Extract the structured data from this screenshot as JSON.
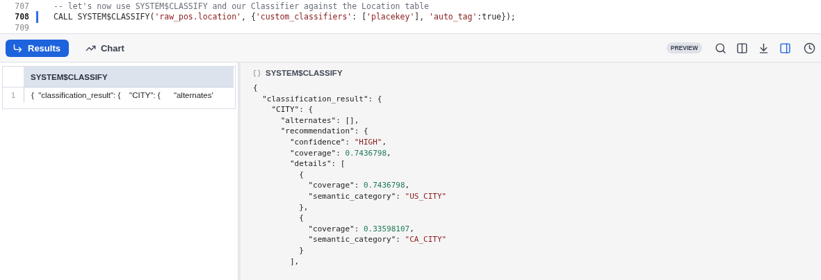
{
  "editor": {
    "lines": [
      {
        "number": "707",
        "active": false,
        "tokens": [
          {
            "kind": "comment",
            "text": "-- let's now use SYSTEM$CLASSIFY and our Classifier against the Location table"
          }
        ]
      },
      {
        "number": "708",
        "active": true,
        "tokens": [
          {
            "kind": "plain",
            "text": "CALL SYSTEM$CLASSIFY("
          },
          {
            "kind": "string",
            "text": "'raw_pos.location'"
          },
          {
            "kind": "plain",
            "text": ", {"
          },
          {
            "kind": "string",
            "text": "'custom_classifiers'"
          },
          {
            "kind": "plain",
            "text": ": ["
          },
          {
            "kind": "string",
            "text": "'placekey'"
          },
          {
            "kind": "plain",
            "text": "], "
          },
          {
            "kind": "string",
            "text": "'auto_tag'"
          },
          {
            "kind": "plain",
            "text": ":true});"
          }
        ]
      },
      {
        "number": "709",
        "active": false
      }
    ]
  },
  "toolbar": {
    "tabs": [
      {
        "label": "Results",
        "selected": true
      },
      {
        "label": "Chart",
        "selected": false
      }
    ],
    "badge": "PREVIEW",
    "actions": [
      {
        "selected": false
      },
      {
        "selected": false
      },
      {
        "selected": false
      },
      {
        "selected": true
      },
      {
        "selected": false
      }
    ]
  },
  "table": {
    "columns": [
      "SYSTEM$CLASSIFY"
    ],
    "rows": [
      {
        "number": "1",
        "cells": [
          "{  \"classification_result\": {    \"CITY\": {      \"alternates'"
        ]
      }
    ]
  },
  "detail": {
    "title": "SYSTEM$CLASSIFY",
    "lines": [
      [
        {
          "kind": "punct",
          "text": "{"
        }
      ],
      [
        {
          "kind": "key",
          "text": "  \"classification_result\": {"
        }
      ],
      [
        {
          "kind": "key",
          "text": "    \"CITY\": {"
        }
      ],
      [
        {
          "kind": "key",
          "text": "      \"alternates\": [],"
        }
      ],
      [
        {
          "kind": "key",
          "text": "      \"recommendation\": {"
        }
      ],
      [
        {
          "kind": "key",
          "text": "        \"confidence\": "
        },
        {
          "kind": "string",
          "text": "\"HIGH\""
        },
        {
          "kind": "punct",
          "text": ","
        }
      ],
      [
        {
          "kind": "key",
          "text": "        \"coverage\": "
        },
        {
          "kind": "number",
          "text": "0.7436798"
        },
        {
          "kind": "punct",
          "text": ","
        }
      ],
      [
        {
          "kind": "key",
          "text": "        \"details\": ["
        }
      ],
      [
        {
          "kind": "punct",
          "text": "          {"
        }
      ],
      [
        {
          "kind": "key",
          "text": "            \"coverage\": "
        },
        {
          "kind": "number",
          "text": "0.7436798"
        },
        {
          "kind": "punct",
          "text": ","
        }
      ],
      [
        {
          "kind": "key",
          "text": "            \"semantic_category\": "
        },
        {
          "kind": "string",
          "text": "\"US_CITY\""
        }
      ],
      [
        {
          "kind": "punct",
          "text": "          },"
        }
      ],
      [
        {
          "kind": "punct",
          "text": "          {"
        }
      ],
      [
        {
          "kind": "key",
          "text": "            \"coverage\": "
        },
        {
          "kind": "number",
          "text": "0.33598107"
        },
        {
          "kind": "punct",
          "text": ","
        }
      ],
      [
        {
          "kind": "key",
          "text": "            \"semantic_category\": "
        },
        {
          "kind": "string",
          "text": "\"CA_CITY\""
        }
      ],
      [
        {
          "kind": "punct",
          "text": "          }"
        }
      ],
      [
        {
          "kind": "punct",
          "text": "        ],"
        }
      ]
    ]
  }
}
